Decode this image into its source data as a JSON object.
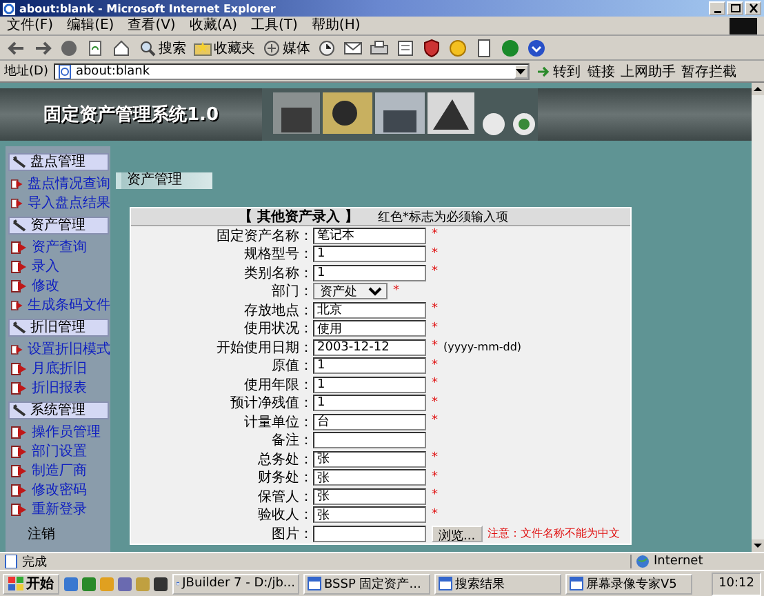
{
  "window": {
    "title": "about:blank - Microsoft Internet Explorer"
  },
  "menu": [
    "文件(F)",
    "编辑(E)",
    "查看(V)",
    "收藏(A)",
    "工具(T)",
    "帮助(H)"
  ],
  "toolbar": {
    "labels": [
      "搜索",
      "收藏夹",
      "媒体"
    ]
  },
  "address": {
    "label": "地址(D)",
    "value": "about:blank",
    "go": "转到",
    "links": "链接",
    "extras": [
      "上网助手",
      "暂存拦截"
    ]
  },
  "app": {
    "title": "固定资产管理系统1.0"
  },
  "sidebar": {
    "groups": [
      {
        "title": "盘点管理",
        "items": [
          "盘点情况查询",
          "导入盘点结果"
        ]
      },
      {
        "title": "资产管理",
        "items": [
          "资产查询",
          "录入",
          "修改",
          "生成条码文件"
        ]
      },
      {
        "title": "折旧管理",
        "items": [
          "设置折旧模式",
          "月底折旧",
          "折旧报表"
        ]
      },
      {
        "title": "系统管理",
        "items": [
          "操作员管理",
          "部门设置",
          "制造厂商",
          "修改密码",
          "重新登录"
        ]
      }
    ],
    "footer": "注销"
  },
  "section": {
    "title": "资产管理"
  },
  "form": {
    "title": "【 其他资产录入 】",
    "note": "红色*标志为必须输入项",
    "required_mark": "*",
    "fields": [
      {
        "kind": "text",
        "label": "固定资产名称：",
        "value": "笔记本",
        "required": true
      },
      {
        "kind": "text",
        "label": "规格型号：",
        "value": "1",
        "required": true
      },
      {
        "kind": "text",
        "label": "类别名称：",
        "value": "1",
        "required": true
      },
      {
        "kind": "select",
        "label": "部门：",
        "value": "资产处",
        "required": true
      },
      {
        "kind": "text",
        "label": "存放地点：",
        "value": "北京",
        "required": true
      },
      {
        "kind": "text",
        "label": "使用状况：",
        "value": "使用",
        "required": true
      },
      {
        "kind": "text",
        "label": "开始使用日期：",
        "value": "2003-12-12",
        "required": true,
        "hint": "(yyyy-mm-dd)"
      },
      {
        "kind": "text",
        "label": "原值：",
        "value": "1",
        "required": true
      },
      {
        "kind": "text",
        "label": "使用年限：",
        "value": "1",
        "required": true
      },
      {
        "kind": "text",
        "label": "预计净残值：",
        "value": "1",
        "required": true
      },
      {
        "kind": "text",
        "label": "计量单位：",
        "value": "台",
        "required": true
      },
      {
        "kind": "text",
        "label": "备注：",
        "required": false
      },
      {
        "kind": "text",
        "label": "总务处：",
        "value": "张",
        "required": true
      },
      {
        "kind": "text",
        "label": "财务处：",
        "value": "张",
        "required": true
      },
      {
        "kind": "text",
        "label": "保管人：",
        "value": "张",
        "required": true
      },
      {
        "kind": "text",
        "label": "验收人：",
        "value": "张",
        "required": true
      },
      {
        "kind": "file",
        "label": "图片：",
        "button": "浏览...",
        "warning": "注意：文件名称不能为中文",
        "required": false
      }
    ]
  },
  "status_bar": {
    "text": "完成",
    "zone": "Internet"
  },
  "taskbar": {
    "start": "开始",
    "tasks": [
      "JBuilder 7 - D:/jb...",
      "BSSP 固定资产...",
      "搜索结果",
      "屏幕录像专家V5"
    ],
    "clock": "10:12"
  }
}
